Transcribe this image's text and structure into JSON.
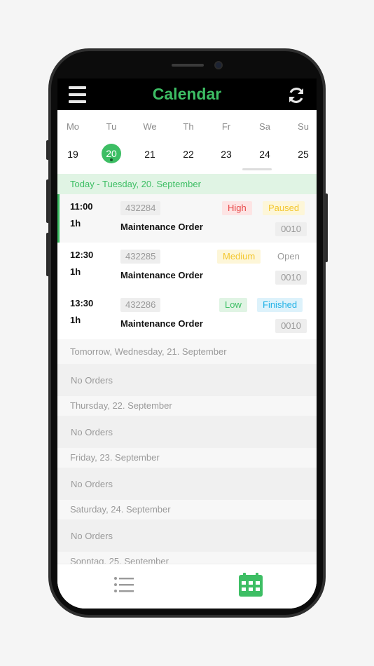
{
  "header": {
    "title": "Calendar",
    "menu_icon": "hamburger-menu-icon",
    "refresh_icon": "refresh-icon"
  },
  "colors": {
    "accent": "#3dbe64",
    "high": "#e84a4a",
    "paused": "#f3c62d",
    "medium": "#f3c62d",
    "low": "#3dbe64",
    "finished": "#1fb1e6"
  },
  "week": {
    "days": [
      {
        "name": "Mo",
        "date": "19"
      },
      {
        "name": "Tu",
        "date": "20"
      },
      {
        "name": "We",
        "date": "21"
      },
      {
        "name": "Th",
        "date": "22"
      },
      {
        "name": "Fr",
        "date": "23"
      },
      {
        "name": "Sa",
        "date": "24"
      },
      {
        "name": "Su",
        "date": "25"
      }
    ],
    "selected": "20"
  },
  "today": {
    "header": "Today - Tuesday, 20. September",
    "orders": [
      {
        "time": "11:00",
        "duration": "1h",
        "number": "432284",
        "type": "Maintenance Order",
        "priority": "High",
        "status": "Paused",
        "code": "0010"
      },
      {
        "time": "12:30",
        "duration": "1h",
        "number": "432285",
        "type": "Maintenance Order",
        "priority": "Medium",
        "status": "Open",
        "code": "0010"
      },
      {
        "time": "13:30",
        "duration": "1h",
        "number": "432286",
        "type": "Maintenance Order",
        "priority": "Low",
        "status": "Finished",
        "code": "0010"
      }
    ]
  },
  "days": [
    {
      "header": "Tomorrow, Wednesday, 21. September",
      "empty": "No Orders"
    },
    {
      "header": "Thursday, 22. September",
      "empty": "No Orders"
    },
    {
      "header": "Friday, 23. September",
      "empty": "No Orders"
    },
    {
      "header": "Saturday, 24. September",
      "empty": "No Orders"
    },
    {
      "header": "Sonntag, 25. September",
      "empty": ""
    }
  ],
  "tabbar": {
    "list_icon": "list-icon",
    "calendar_icon": "calendar-icon"
  }
}
